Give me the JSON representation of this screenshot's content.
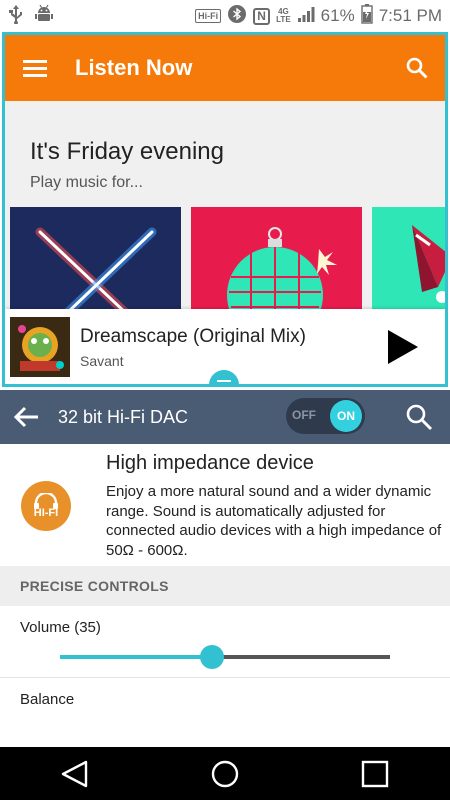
{
  "status_bar": {
    "hifi_chip": "Hi-Fi",
    "n_chip": "N",
    "lte": "4G\nLTE",
    "battery_percent": "61%",
    "time": "7:51 PM",
    "icons": [
      "usb-icon",
      "android-debug-icon",
      "bluetooth-icon",
      "nfc-icon",
      "signal-icon",
      "battery-icon"
    ]
  },
  "music_app": {
    "title": "Listen Now",
    "greeting": "It's Friday evening",
    "subtitle": "Play music for...",
    "accent_color": "#f57a0a",
    "cards": [
      {
        "name": "lightsabers-card",
        "color": "#1d2a5e"
      },
      {
        "name": "disco-ball-card",
        "color": "#e81b4d"
      },
      {
        "name": "cocktail-card",
        "color": "#2ee6b6"
      }
    ],
    "now_playing": {
      "title": "Dreamscape (Original Mix)",
      "artist": "Savant"
    }
  },
  "settings": {
    "title": "32 bit Hi-Fi DAC",
    "toggle_off": "OFF",
    "toggle_on": "ON",
    "toggle_state": "on",
    "bar_color": "#4a5b74",
    "badge_label": "HI-FI",
    "high_impedance_title": "High impedance device",
    "high_impedance_desc": "Enjoy a more natural sound and a wider dynamic range. Sound is automatically adjusted for connected audio devices with a high impedance of 50Ω - 600Ω.",
    "section_header": "PRECISE CONTROLS",
    "volume_label": "Volume  (35)",
    "volume_fraction": 0.46,
    "balance_label": "Balance"
  },
  "nav_bar": {
    "icons": [
      "back-icon",
      "home-icon",
      "recents-icon"
    ]
  }
}
